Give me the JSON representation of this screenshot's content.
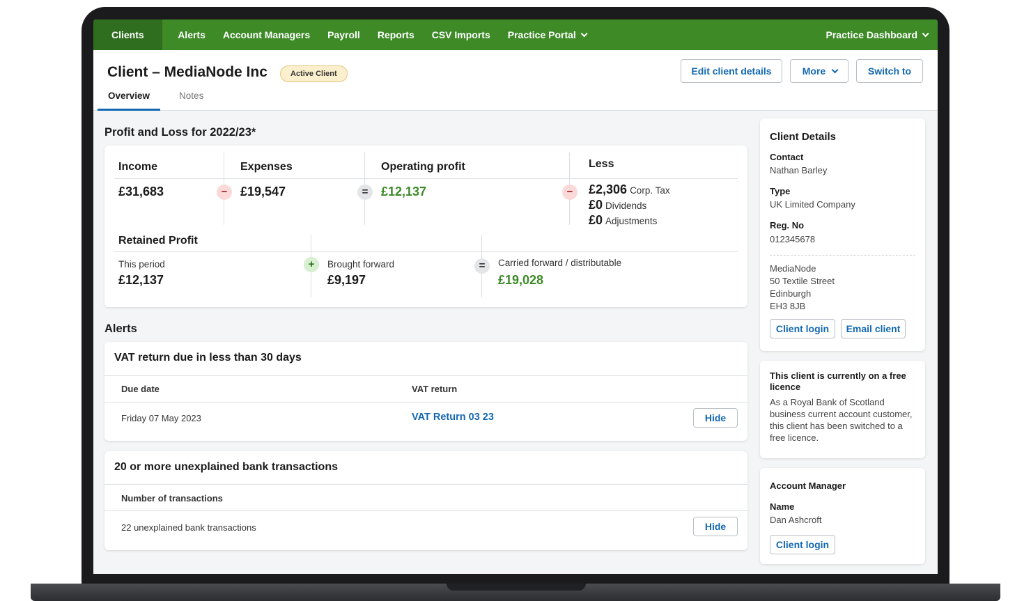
{
  "nav": {
    "items": [
      "Clients",
      "Alerts",
      "Account Managers",
      "Payroll",
      "Reports",
      "CSV Imports"
    ],
    "practice_portal": "Practice Portal",
    "practice_dashboard": "Practice Dashboard"
  },
  "header": {
    "title": "Client – MediaNode Inc",
    "badge": "Active Client",
    "buttons": {
      "edit": "Edit client details",
      "more": "More",
      "switch": "Switch to"
    },
    "tabs": [
      "Overview",
      "Notes"
    ]
  },
  "pl": {
    "title": "Profit and Loss for 2022/23*",
    "income_label": "Income",
    "income": "£31,683",
    "expenses_label": "Expenses",
    "expenses": "£19,547",
    "operating_label": "Operating profit",
    "operating": "£12,137",
    "less_label": "Less",
    "less": [
      {
        "value": "£2,306",
        "label": "Corp. Tax"
      },
      {
        "value": "£0",
        "label": "Dividends"
      },
      {
        "value": "£0",
        "label": "Adjustments"
      }
    ],
    "retained_label": "Retained Profit",
    "this_period_label": "This period",
    "this_period": "£12,137",
    "brought_label": "Brought forward",
    "brought": "£9,197",
    "carried_label": "Carried forward / distributable",
    "carried": "£19,028",
    "ops": {
      "minus": "−",
      "eq": "=",
      "plus": "+"
    }
  },
  "alerts": {
    "title": "Alerts",
    "vat": {
      "title": "VAT return due in less than 30 days",
      "col1": "Due date",
      "col2": "VAT return",
      "date": "Friday 07 May 2023",
      "link": "VAT Return 03 23",
      "hide": "Hide"
    },
    "bank": {
      "title": "20 or more unexplained bank transactions",
      "col1": "Number of transactions",
      "value": "22 unexplained bank transactions",
      "hide": "Hide"
    }
  },
  "client_details": {
    "title": "Client Details",
    "contact_label": "Contact",
    "contact": "Nathan Barley",
    "type_label": "Type",
    "type": "UK Limited Company",
    "reg_label": "Reg. No",
    "reg": "012345678",
    "address": [
      "MediaNode",
      "50 Textile Street",
      "Edinburgh",
      "EH3 8JB"
    ],
    "login": "Client login",
    "email": "Email client"
  },
  "licence": {
    "title": "This client is currently on a free licence",
    "body": "As a Royal Bank of Scotland business current account customer, this client has been switched to a free licence."
  },
  "account_manager": {
    "title": "Account Manager",
    "name_label": "Name",
    "name": "Dan Ashcroft",
    "login": "Client login"
  },
  "colors": {
    "nav_green": "#3d8a27",
    "link_blue": "#1368b3",
    "profit_green": "#3d8a27"
  }
}
